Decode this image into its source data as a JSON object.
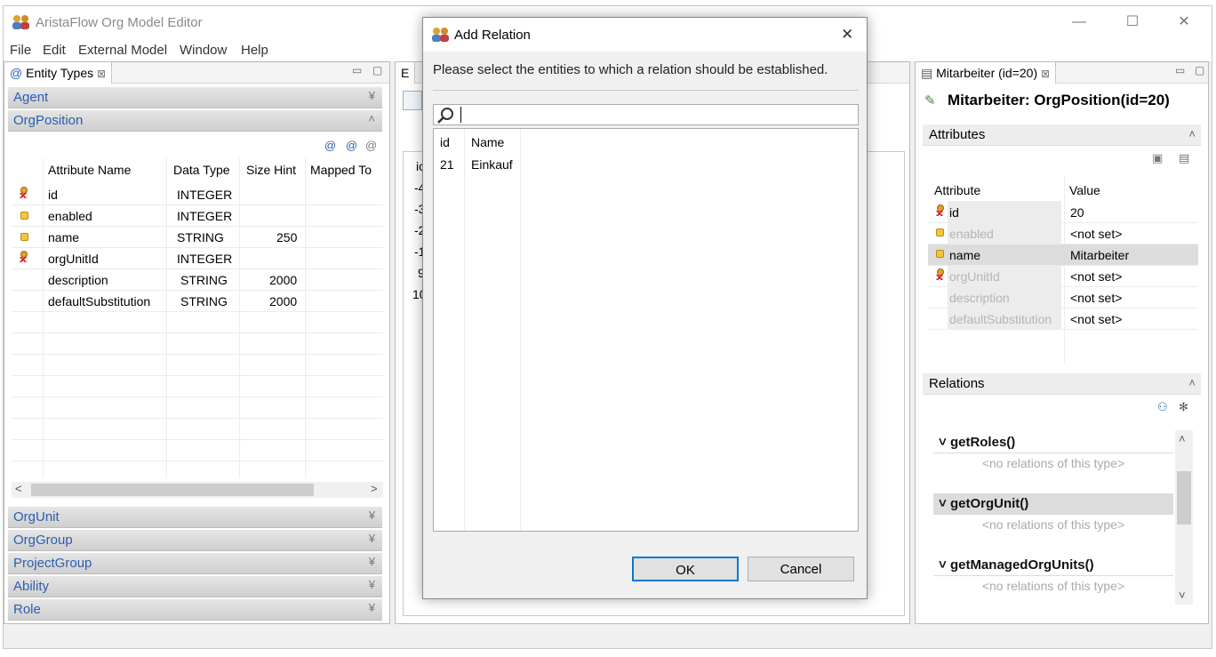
{
  "app": {
    "title": "AristaFlow Org Model Editor"
  },
  "window_controls": {
    "minimize": "—",
    "maximize": "☐",
    "close": "✕"
  },
  "menu": [
    "File",
    "Edit",
    "External Model",
    "Window",
    "Help"
  ],
  "entity_panel": {
    "tab_label": "Entity Types",
    "tab_close": "⊠",
    "sections_top": [
      "Agent",
      "OrgPosition"
    ],
    "sections_bottom": [
      "OrgUnit",
      "OrgGroup",
      "ProjectGroup",
      "Ability",
      "Role"
    ],
    "columns": [
      "Attribute Name",
      "Data Type",
      "Size Hint",
      "Mapped To"
    ],
    "rows": [
      {
        "icon": "key",
        "name": "id",
        "type": "INTEGER",
        "size": ""
      },
      {
        "icon": "lock",
        "name": "enabled",
        "type": "INTEGER",
        "size": ""
      },
      {
        "icon": "lock",
        "name": "name",
        "type": "STRING",
        "size": "250"
      },
      {
        "icon": "key",
        "name": "orgUnitId",
        "type": "INTEGER",
        "size": ""
      },
      {
        "icon": "none",
        "name": "description",
        "type": "STRING",
        "size": "2000"
      },
      {
        "icon": "none",
        "name": "defaultSubstitution",
        "type": "STRING",
        "size": "2000"
      }
    ]
  },
  "middle_panel": {
    "tab_label": "E",
    "col_header": "ic",
    "rows": [
      "-4",
      "-3",
      "-2",
      "-1",
      "9",
      "10"
    ]
  },
  "dialog": {
    "title": "Add Relation",
    "close": "✕",
    "message": "Please select the entities to which a relation should be established.",
    "search_value": "",
    "columns": [
      "id",
      "Name"
    ],
    "rows": [
      {
        "id": "21",
        "name": "Einkauf"
      }
    ],
    "ok": "OK",
    "cancel": "Cancel"
  },
  "details_panel": {
    "tab_label": "Mitarbeiter (id=20)",
    "tab_close": "⊠",
    "heading": "Mitarbeiter: OrgPosition(id=20)",
    "attributes_section": "Attributes",
    "attr_columns": [
      "Attribute",
      "Value"
    ],
    "attributes": [
      {
        "icon": "key",
        "name": "id",
        "value": "20",
        "enabled": true
      },
      {
        "icon": "lock",
        "name": "enabled",
        "value": "<not set>",
        "enabled": false
      },
      {
        "icon": "lock",
        "name": "name",
        "value": "Mitarbeiter",
        "enabled": true
      },
      {
        "icon": "key",
        "name": "orgUnitId",
        "value": "<not set>",
        "enabled": false
      },
      {
        "icon": "none",
        "name": "description",
        "value": "<not set>",
        "enabled": false
      },
      {
        "icon": "none",
        "name": "defaultSubstitution",
        "value": "<not set>",
        "enabled": false
      }
    ],
    "relations_section": "Relations",
    "relations": [
      {
        "name": "getRoles()",
        "empty": "<no relations of this type>"
      },
      {
        "name": "getOrgUnit()",
        "empty": "<no relations of this type>"
      },
      {
        "name": "getManagedOrgUnits()",
        "empty": "<no relations of this type>"
      }
    ]
  }
}
